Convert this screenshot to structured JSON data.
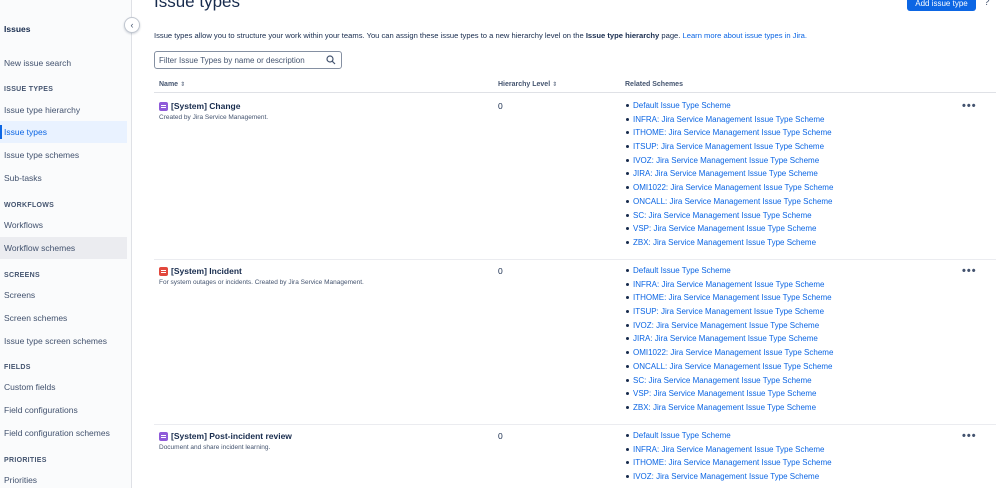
{
  "sidebar": {
    "title": "Issues",
    "items": [
      {
        "label": "New issue search"
      },
      {
        "label": "Issue type hierarchy"
      },
      {
        "label": "Issue types"
      },
      {
        "label": "Issue type schemes"
      },
      {
        "label": "Sub-tasks"
      },
      {
        "label": "Workflows"
      },
      {
        "label": "Workflow schemes"
      },
      {
        "label": "Screens"
      },
      {
        "label": "Screen schemes"
      },
      {
        "label": "Issue type screen schemes"
      },
      {
        "label": "Custom fields"
      },
      {
        "label": "Field configurations"
      },
      {
        "label": "Field configuration schemes"
      },
      {
        "label": "Priorities"
      }
    ],
    "sections": [
      {
        "label": "ISSUE TYPES"
      },
      {
        "label": "WORKFLOWS"
      },
      {
        "label": "SCREENS"
      },
      {
        "label": "FIELDS"
      },
      {
        "label": "PRIORITIES"
      }
    ],
    "active": "Issue types"
  },
  "header": {
    "title": "Issue types",
    "add_button": "Add issue type",
    "help": "?"
  },
  "intro": {
    "text_before": "Issue types allow you to structure your work within your teams. You can assign these issue types to a new hierarchy level on the ",
    "bold": "Issue type hierarchy",
    "text_after": " page. ",
    "link": "Learn more about issue types in Jira."
  },
  "search": {
    "placeholder": "Filter Issue Types by name or description",
    "value": ""
  },
  "table": {
    "columns": [
      {
        "label": "Name",
        "sort": "⇕"
      },
      {
        "label": "Hierarchy Level",
        "sort": "⇕"
      },
      {
        "label": "Related Schemes"
      }
    ],
    "rows": [
      {
        "icon": "change-issue-icon",
        "name": "[System] Change",
        "description": "Created by Jira Service Management.",
        "level": "0",
        "schemes": [
          "Default Issue Type Scheme",
          "INFRA: Jira Service Management Issue Type Scheme",
          "ITHOME: Jira Service Management Issue Type Scheme",
          "ITSUP: Jira Service Management Issue Type Scheme",
          "IVOZ: Jira Service Management Issue Type Scheme",
          "JIRA: Jira Service Management Issue Type Scheme",
          "OMI1022: Jira Service Management Issue Type Scheme",
          "ONCALL: Jira Service Management Issue Type Scheme",
          "SC: Jira Service Management Issue Type Scheme",
          "VSP: Jira Service Management Issue Type Scheme",
          "ZBX: Jira Service Management Issue Type Scheme"
        ],
        "more": "•••"
      },
      {
        "icon": "incident-issue-icon",
        "name": "[System] Incident",
        "description": "For system outages or incidents. Created by Jira Service Management.",
        "level": "0",
        "schemes": [
          "Default Issue Type Scheme",
          "INFRA: Jira Service Management Issue Type Scheme",
          "ITHOME: Jira Service Management Issue Type Scheme",
          "ITSUP: Jira Service Management Issue Type Scheme",
          "IVOZ: Jira Service Management Issue Type Scheme",
          "JIRA: Jira Service Management Issue Type Scheme",
          "OMI1022: Jira Service Management Issue Type Scheme",
          "ONCALL: Jira Service Management Issue Type Scheme",
          "SC: Jira Service Management Issue Type Scheme",
          "VSP: Jira Service Management Issue Type Scheme",
          "ZBX: Jira Service Management Issue Type Scheme"
        ],
        "more": "•••"
      },
      {
        "icon": "post-incident-review-icon",
        "name": "[System] Post-incident review",
        "description": "Document and share incident learning.",
        "level": "0",
        "schemes": [
          "Default Issue Type Scheme",
          "INFRA: Jira Service Management Issue Type Scheme",
          "ITHOME: Jira Service Management Issue Type Scheme",
          "IVOZ: Jira Service Management Issue Type Scheme"
        ],
        "more": "•••"
      }
    ]
  },
  "colors": {
    "accent": "#0c66e4",
    "change_icon": "#8f5bd9",
    "incident_icon": "#e2483d",
    "active_bg": "#e9f2ff"
  }
}
